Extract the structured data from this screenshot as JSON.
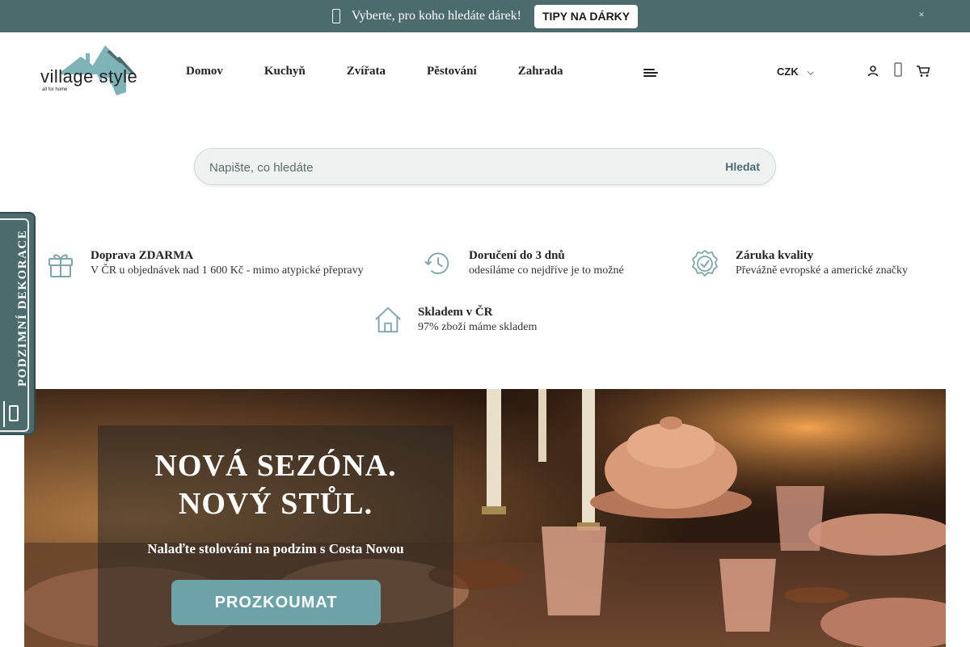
{
  "colors": {
    "brand": "#4c6b6d",
    "accent": "#6da3a8",
    "search_bg": "#eef3f2"
  },
  "announcement": {
    "icon": "gift-icon",
    "message": "Vyberte, pro koho hledáte dárek!",
    "button_label": "TIPY NA DÁRKY",
    "close_icon": "close-icon"
  },
  "header": {
    "logo_text": "village style",
    "logo_tagline": "all for home",
    "nav": [
      {
        "label": "Domov"
      },
      {
        "label": "Kuchyň"
      },
      {
        "label": "Zvířata"
      },
      {
        "label": "Pěstování"
      },
      {
        "label": "Zahrada"
      }
    ],
    "menu_icon": "hamburger-menu-icon",
    "currency": "CZK",
    "icons": [
      "user-icon",
      "heart-icon",
      "cart-icon"
    ]
  },
  "search": {
    "placeholder": "Napište, co hledáte",
    "value": "",
    "button_label": "Hledat"
  },
  "features": [
    {
      "icon": "gift-icon",
      "title": "Doprava ZDARMA",
      "subtitle": "V ČR u objednávek nad 1 600 Kč - mimo atypické přepravy"
    },
    {
      "icon": "clock-history-icon",
      "title": "Doručení do 3 dnů",
      "subtitle": "odesíláme co nejdříve je to možné"
    },
    {
      "icon": "quality-badge-icon",
      "title": "Záruka kvality",
      "subtitle": "Převážně evropské a americké značky"
    },
    {
      "icon": "house-icon",
      "title": "Skladem v ČR",
      "subtitle": "97% zboží máme skladem"
    }
  ],
  "side_tab": {
    "label": "PODZIMNÍ DEKORACE",
    "icon": "gift-icon"
  },
  "hero": {
    "title_line1": "NOVÁ SEZÓNA.",
    "title_line2": "NOVÝ STŮL.",
    "subtitle": "Nalaďte stolování na podzim s Costa Novou",
    "cta_label": "PROZKOUMAT"
  }
}
